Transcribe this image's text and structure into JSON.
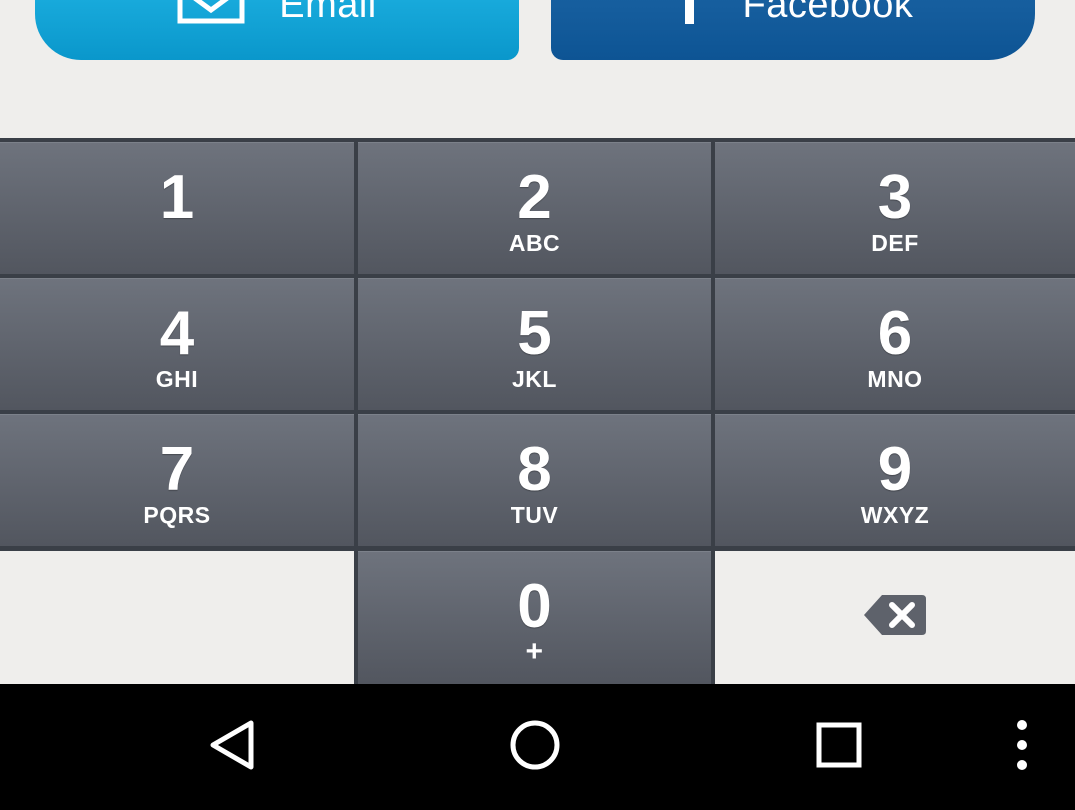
{
  "share": {
    "email_label": "Email",
    "facebook_label": "Facebook",
    "email_icon": "envelope-icon",
    "facebook_icon": "facebook-f-icon"
  },
  "keypad": {
    "keys": [
      {
        "digit": "1",
        "letters": ""
      },
      {
        "digit": "2",
        "letters": "ABC"
      },
      {
        "digit": "3",
        "letters": "DEF"
      },
      {
        "digit": "4",
        "letters": "GHI"
      },
      {
        "digit": "5",
        "letters": "JKL"
      },
      {
        "digit": "6",
        "letters": "MNO"
      },
      {
        "digit": "7",
        "letters": "PQRS"
      },
      {
        "digit": "8",
        "letters": "TUV"
      },
      {
        "digit": "9",
        "letters": "WXYZ"
      },
      {
        "digit": "0",
        "letters": "+"
      }
    ],
    "backspace_icon": "backspace-icon"
  },
  "navbar": {
    "back_icon": "back-triangle-icon",
    "home_icon": "home-circle-icon",
    "recents_icon": "recents-square-icon",
    "menu_icon": "overflow-menu-icon"
  },
  "colors": {
    "email_blue": "#0a97cb",
    "facebook_blue": "#0d5494",
    "key_gray": "#5f636c"
  }
}
